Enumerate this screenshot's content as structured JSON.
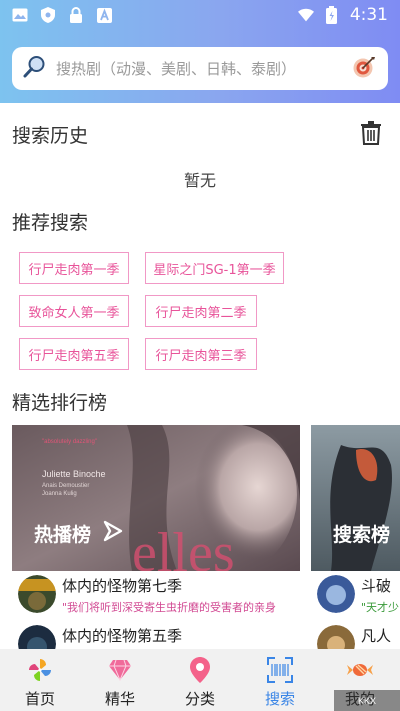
{
  "status_bar": {
    "time": "4:31"
  },
  "search": {
    "placeholder": "搜热剧（动漫、美剧、日韩、泰剧）"
  },
  "history": {
    "title": "搜索历史",
    "empty_text": "暂无"
  },
  "recommend": {
    "title": "推荐搜索",
    "tags": [
      "行尸走肉第一季",
      "星际之门SG-1第一季",
      "致命女人第一季",
      "行尸走肉第二季",
      "行尸走肉第五季",
      "行尸走肉第三季"
    ]
  },
  "ranking": {
    "title": "精选排行榜",
    "cards": [
      {
        "label": "热播榜",
        "poster_text": {
          "line1": "Juliette Binoche",
          "line2": "Anais Demoustier",
          "line3": "Joanna Kulig",
          "big": "elles",
          "quote": "\"absolutely dazzling\""
        },
        "items": [
          {
            "title": "体内的怪物第七季",
            "subtitle": "\"我们将听到深受寄生虫折磨的受害者的亲身"
          },
          {
            "title": "体内的怪物第五季",
            "subtitle": ""
          }
        ]
      },
      {
        "label": "搜索榜",
        "items": [
          {
            "title": "斗破",
            "subtitle": "\"天才少"
          },
          {
            "title": "凡人",
            "subtitle": ""
          }
        ]
      }
    ]
  },
  "bottom_nav": [
    {
      "label": "首页",
      "icon": "pinwheel-icon"
    },
    {
      "label": "精华",
      "icon": "diamond-icon"
    },
    {
      "label": "分类",
      "icon": "location-pin-icon"
    },
    {
      "label": "搜索",
      "icon": "scan-icon",
      "active": true
    },
    {
      "label": "我的",
      "icon": "candy-icon"
    }
  ],
  "colors": {
    "accent": "#3a85e6",
    "tag_border": "#f198c6",
    "tag_text": "#e8549a",
    "subtitle_pink": "#d24a93"
  }
}
